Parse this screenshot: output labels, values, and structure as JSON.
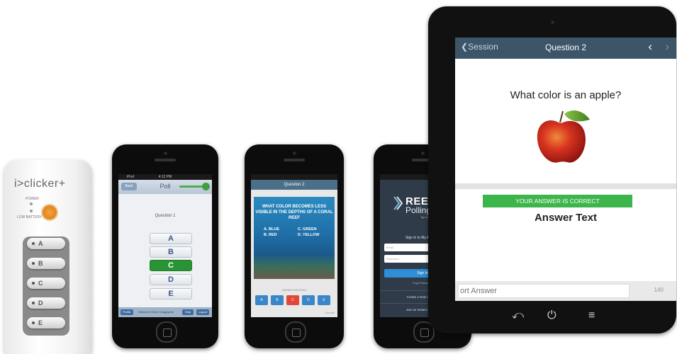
{
  "clicker": {
    "brand": "i>clicker+",
    "power_label": "POWER",
    "low_battery_label": "LOW BATTERY",
    "buttons": [
      "A",
      "B",
      "C",
      "D",
      "E"
    ]
  },
  "poll_phone": {
    "status": {
      "carrier": "iPod",
      "time": "4:12 PM"
    },
    "back_label": "Back",
    "title": "Poll",
    "question": "Question 1",
    "answers": [
      "A",
      "B",
      "C",
      "D",
      "E"
    ],
    "selected_answer": "C",
    "footer": {
      "left": "Profile",
      "center": "Welcome Oliver Onagoyemi",
      "help": "Help",
      "logout": "Logout"
    }
  },
  "quiz_phone": {
    "header": "Question 2",
    "question": "WHAT COLOR BECOMES LESS VISIBLE IN THE DEPTHS OF A CORAL REEF",
    "options_left": [
      "A. BLUE",
      "B. RED"
    ],
    "options_right": [
      "C. GREEN",
      "D. YELLOW"
    ],
    "answer_label": "ANSWER RECEIVED",
    "answer_buttons": [
      "A",
      "B",
      "C",
      "D",
      "E"
    ],
    "selected_answer": "C",
    "results_link": "Results"
  },
  "reef_phone": {
    "logo_main": "REEF",
    "logo_sub": "Polling",
    "logo_by": "by i>clicker",
    "sign_in_heading": "Sign in to My Account",
    "email_placeholder": "Email",
    "password_placeholder": "Password",
    "sign_in_button": "Sign In",
    "forgot": "Forgot Password?",
    "create_account": "Create a New Account",
    "join_session": "Join an Instant Session"
  },
  "tablet": {
    "back_label": "Session",
    "title": "Question 2",
    "question": "What color is an apple?",
    "correct_banner": "YOUR ANSWER IS CORRECT",
    "answer_text": "Answer Text",
    "input_placeholder": "ort Answer",
    "char_count": "140"
  },
  "colors": {
    "selected_green": "#2a9434",
    "tablet_nav": "#3d5568",
    "correct_green": "#3cb54a",
    "clicker_power": "#e0862a"
  }
}
